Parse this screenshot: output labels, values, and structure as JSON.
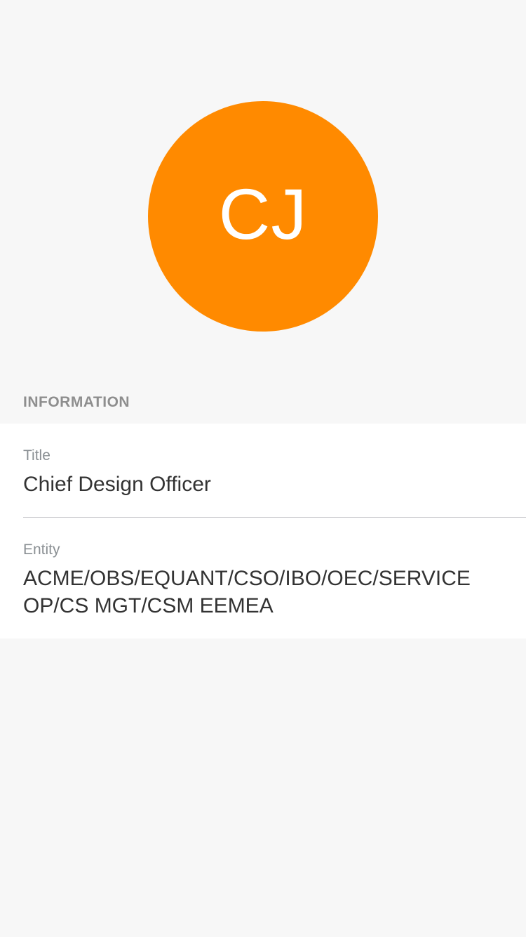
{
  "avatar": {
    "initials": "CJ",
    "color": "#ff8a00"
  },
  "section": {
    "header": "INFORMATION"
  },
  "fields": {
    "title": {
      "label": "Title",
      "value": "Chief Design Officer"
    },
    "entity": {
      "label": "Entity",
      "value": "ACME/OBS/EQUANT/CSO/IBO/OEC/SERVICE OP/CS MGT/CSM EEMEA"
    }
  }
}
